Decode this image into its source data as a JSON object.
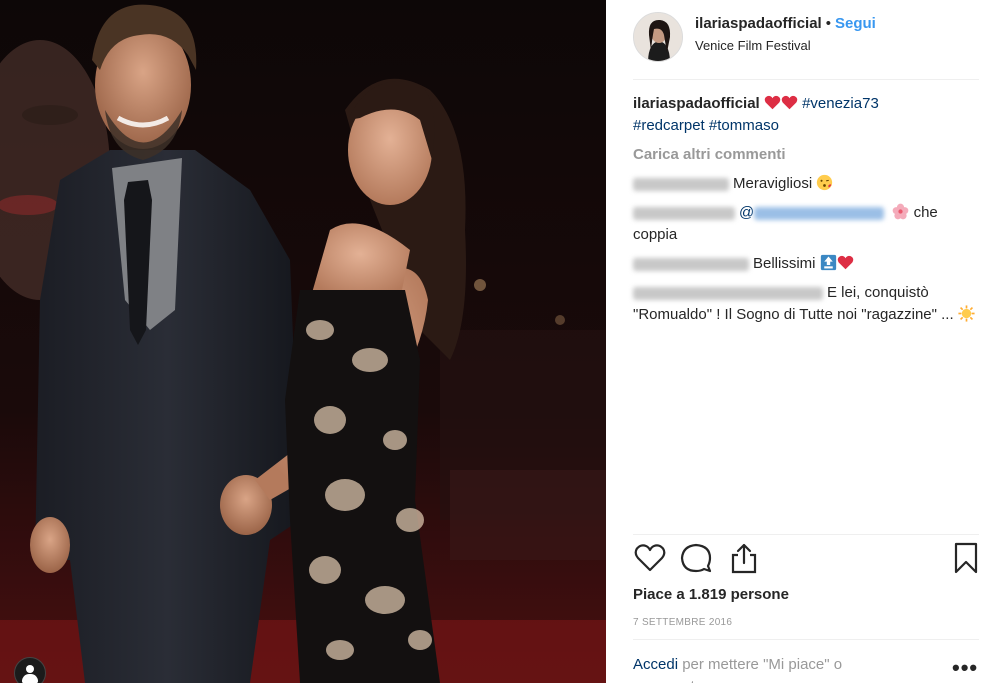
{
  "post": {
    "username": "ilariaspadaofficial",
    "separator": "•",
    "follow_label": "Segui",
    "location": "Venice Film Festival"
  },
  "caption": {
    "username": "ilariaspadaofficial",
    "hashtags": [
      "#venezia73",
      "#redcarpet",
      "#tommaso"
    ],
    "emojis": [
      "red-heart-icon",
      "red-heart-icon"
    ]
  },
  "load_more_label": "Carica altri commenti",
  "comments": [
    {
      "text": "Meravigliosi",
      "emoji": "kissing-face-icon"
    },
    {
      "mention_prefix": "@",
      "text": "che coppia",
      "emoji": "hibiscus-icon"
    },
    {
      "text": "Bellissimi",
      "emojis": [
        "top-arrow-icon",
        "red-heart-icon"
      ]
    },
    {
      "text": "E lei, conquistò \"Romualdo\" ! Il Sogno di Tutte noi \"ragazzine\" ...",
      "emoji": "sun-icon"
    }
  ],
  "actions": {
    "like_icon": "heart-outline-icon",
    "comment_icon": "comment-bubble-icon",
    "share_icon": "share-upload-icon",
    "save_icon": "bookmark-icon"
  },
  "likes_text": "Piace a 1.819 persone",
  "date": "7 SETTEMBRE 2016",
  "login": {
    "link": "Accedi",
    "rest": "per mettere \"Mi piace\" o commentare."
  },
  "more_label": "•••",
  "colors": {
    "link_blue": "#3897f0",
    "hashtag_blue": "#003569",
    "muted_gray": "#999999",
    "text": "#262626"
  }
}
